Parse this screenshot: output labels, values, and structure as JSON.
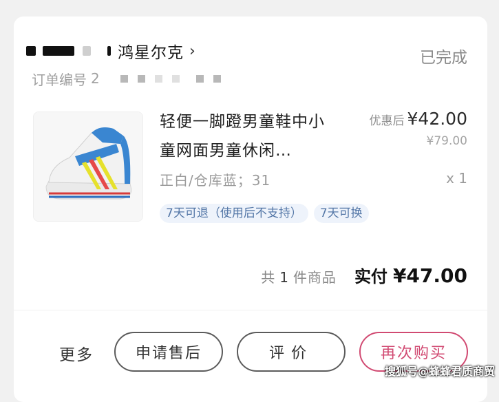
{
  "order": {
    "store_name": "鸿星尔克",
    "status": "已完成",
    "order_no_label": "订单编号",
    "order_no_visible": "2"
  },
  "product": {
    "title": "轻便一脚蹬男童鞋中小童网面男童休闲…",
    "sku": "正白/仓库蓝；31",
    "price_prefix": "优惠后",
    "price": "¥42.00",
    "original_price": "¥79.00",
    "quantity": "x 1",
    "tags": [
      "7天可退（使用后不支持）",
      "7天可换"
    ]
  },
  "summary": {
    "count_prefix": "共",
    "count": "1",
    "count_suffix": "件商品",
    "paid_label": "实付",
    "paid_value": "¥47.00"
  },
  "actions": {
    "more": "更多",
    "after_sales": "申请售后",
    "review": "评价",
    "rebuy": "再次购买"
  },
  "watermark": "搜狐号@蜂蜂君质商贸",
  "colors": {
    "accent": "#d14a72",
    "tag_bg": "#eef3fb",
    "tag_text": "#5477a7"
  },
  "icons": {
    "store_chevron": "chevron-right-icon"
  }
}
